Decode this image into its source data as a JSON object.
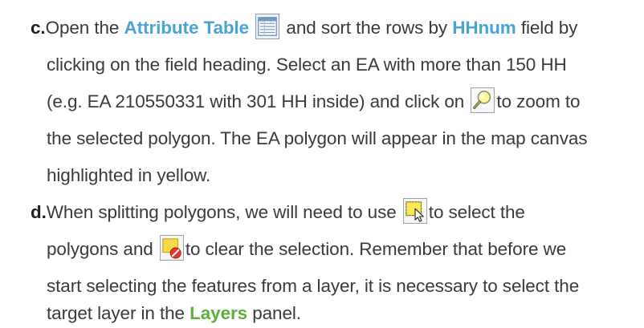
{
  "items": [
    {
      "marker": "c.",
      "lines": [
        [
          "Open the ",
          "Attribute Table",
          "and sort the rows by ",
          "HHnum",
          " field by"
        ],
        [
          "clicking on the field heading. Select an EA with more than 150 HH"
        ],
        [
          "(e.g. EA 210550331 with 301 HH inside) and click on ",
          "to zoom to"
        ],
        [
          "the selected polygon. The EA polygon will appear in the map canvas"
        ],
        [
          "highlighted in yellow."
        ]
      ]
    },
    {
      "marker": "d.",
      "lines": [
        [
          "When splitting polygons, we will need to use ",
          "to select the"
        ],
        [
          "polygons and ",
          "to clear the selection. Remember that before we"
        ],
        [
          "start selecting the features from a layer, it is necessary to select the"
        ],
        [
          "target layer in the ",
          "Layers",
          " panel."
        ]
      ]
    }
  ],
  "icons": {
    "attribute_table": "attribute-table-icon",
    "zoom_to_selected": "zoom-to-selected-icon",
    "select_features": "select-features-icon",
    "clear_selection": "clear-selection-icon"
  },
  "colors": {
    "text": "#3a3a3a",
    "highlight_blue": "#4aa3d8",
    "highlight_green": "#5ab03a"
  }
}
